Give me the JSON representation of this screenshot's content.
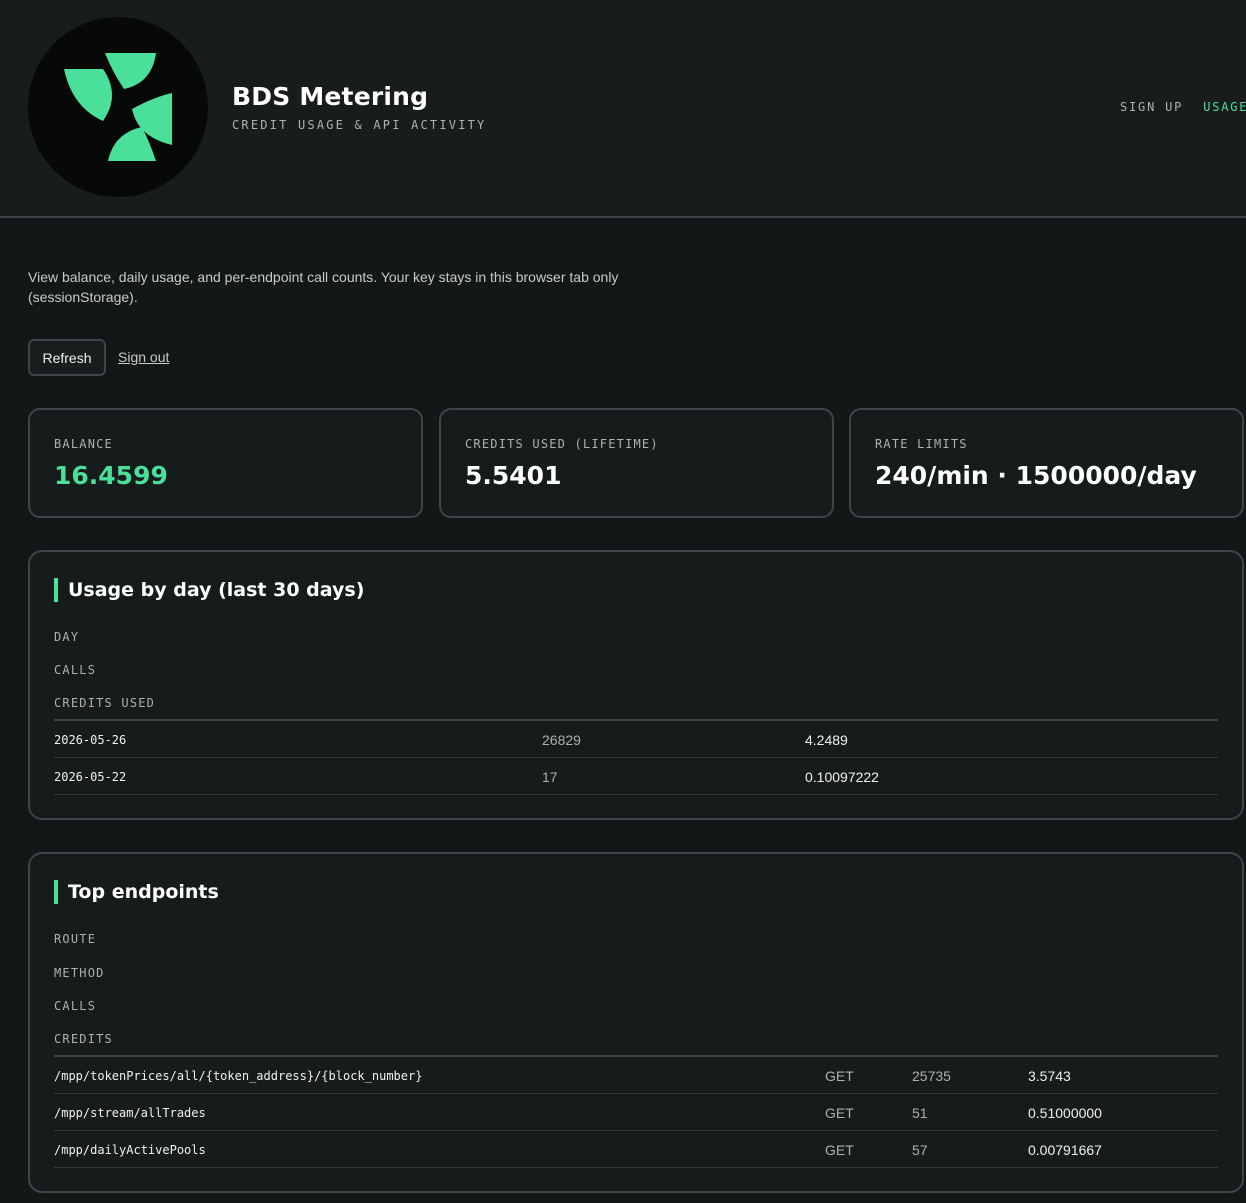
{
  "header": {
    "logo": "bds-logo",
    "title": "BDS Metering",
    "subtitle": "CREDIT USAGE & API ACTIVITY",
    "nav": {
      "sign_up": "SIGN UP",
      "usage": "USAGE"
    },
    "accent": "#4be09a"
  },
  "intro": {
    "text": "View balance, daily usage, and per-endpoint call counts. Your key stays in this browser tab only (sessionStorage).",
    "refresh_label": "Refresh",
    "sign_out_label": "Sign out"
  },
  "stats": {
    "balance": {
      "label": "BALANCE",
      "value": "16.4599"
    },
    "credits_used": {
      "label": "CREDITS USED (LIFETIME)",
      "value": "5.5401"
    },
    "rate_limits": {
      "label": "RATE LIMITS",
      "value": "240/min · 1500000/day"
    }
  },
  "usage_by_day": {
    "title": "Usage by day (last 30 days)",
    "columns": [
      "DAY",
      "CALLS",
      "CREDITS USED"
    ],
    "rows": [
      {
        "day": "2026-05-26",
        "calls": "26829",
        "credits": "4.2489"
      },
      {
        "day": "2026-05-22",
        "calls": "17",
        "credits": "0.10097222"
      }
    ]
  },
  "top_endpoints": {
    "title": "Top endpoints",
    "columns": [
      "ROUTE",
      "METHOD",
      "CALLS",
      "CREDITS"
    ],
    "rows": [
      {
        "route": "/mpp/tokenPrices/all/{token_address}/{block_number}",
        "method": "GET",
        "calls": "25735",
        "credits": "3.5743"
      },
      {
        "route": "/mpp/stream/allTrades",
        "method": "GET",
        "calls": "51",
        "credits": "0.51000000"
      },
      {
        "route": "/mpp/dailyActivePools",
        "method": "GET",
        "calls": "57",
        "credits": "0.00791667"
      }
    ]
  }
}
